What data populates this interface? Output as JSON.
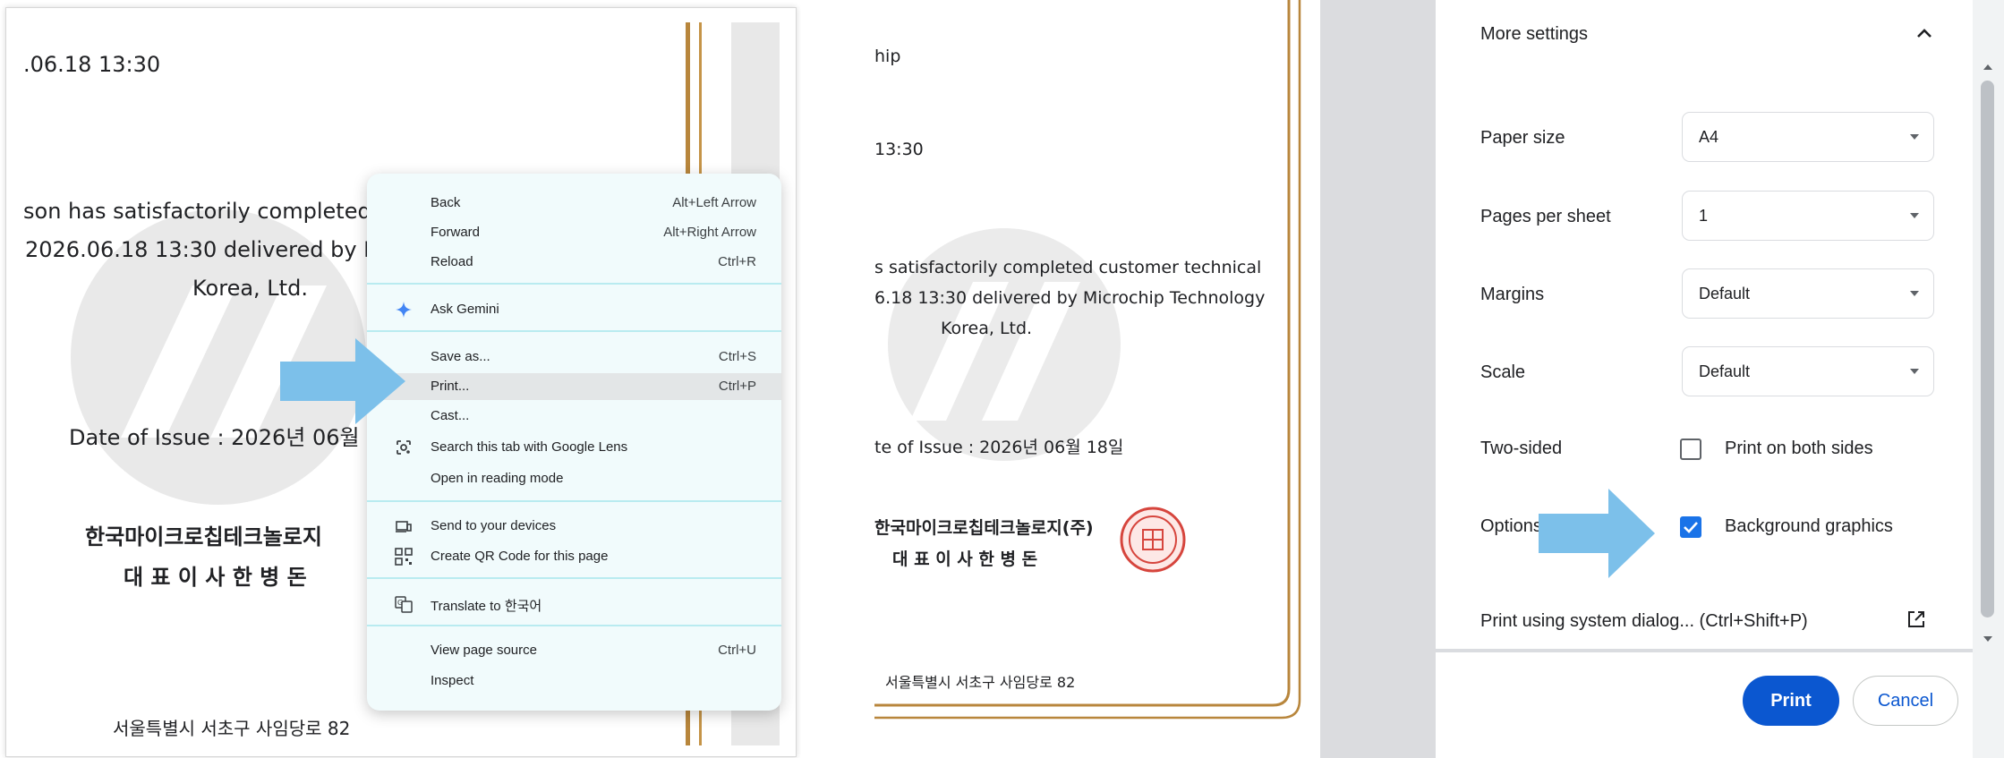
{
  "left_doc": {
    "datetime": ".06.18 13:30",
    "line1": "son has satisfactorily completed",
    "line2": "2026.06.18 13:30 delivered by M",
    "line3": "Korea, Ltd.",
    "issue": "Date of Issue : 2026년 06월",
    "company": "한국마이크로칩테크놀로지",
    "ceo": "대 표 이 사  한 병 돈",
    "address": "서울특별시 서초구 사임당로 82"
  },
  "context_menu": {
    "items": [
      {
        "label": "Back",
        "shortcut": "Alt+Left Arrow"
      },
      {
        "label": "Forward",
        "shortcut": "Alt+Right Arrow"
      },
      {
        "label": "Reload",
        "shortcut": "Ctrl+R"
      },
      {
        "label": "Ask Gemini",
        "icon": "gemini-sparkle-icon"
      },
      {
        "label": "Save as...",
        "shortcut": "Ctrl+S"
      },
      {
        "label": "Print...",
        "shortcut": "Ctrl+P",
        "highlighted": true
      },
      {
        "label": "Cast..."
      },
      {
        "label": "Search this tab with Google Lens",
        "icon": "google-lens-icon"
      },
      {
        "label": "Open in reading mode"
      },
      {
        "label": "Send to your devices",
        "icon": "devices-icon"
      },
      {
        "label": "Create QR Code for this page",
        "icon": "qr-code-icon"
      },
      {
        "label": "Translate to 한국어",
        "icon": "translate-icon"
      },
      {
        "label": "View page source",
        "shortcut": "Ctrl+U"
      },
      {
        "label": "Inspect"
      }
    ]
  },
  "right_doc": {
    "line0": "hip",
    "datetime": "13:30",
    "line1": "s satisfactorily completed customer technical",
    "line2": "6.18 13:30 delivered by Microchip Technology",
    "line3": "Korea, Ltd.",
    "issue": "te of Issue : 2026년 06월 18일",
    "company": "한국마이크로칩테크놀로지(주)",
    "ceo": "대 표 이 사  한 병 돈",
    "address": "서울특별시 서초구 사임당로 82"
  },
  "print_settings": {
    "section_title": "More settings",
    "paper_size": {
      "label": "Paper size",
      "value": "A4"
    },
    "pages_per_sheet": {
      "label": "Pages per sheet",
      "value": "1"
    },
    "margins": {
      "label": "Margins",
      "value": "Default"
    },
    "scale": {
      "label": "Scale",
      "value": "Default"
    },
    "two_sided": {
      "label": "Two-sided",
      "checkbox_label": "Print on both sides",
      "checked": false
    },
    "options": {
      "label": "Options",
      "checkbox_label": "Background graphics",
      "checked": true
    },
    "system_dialog": "Print using system dialog... (Ctrl+Shift+P)",
    "print_button": "Print",
    "cancel_button": "Cancel"
  },
  "colors": {
    "accent_blue": "#0b57d0",
    "checkbox_blue": "#1a73e8",
    "arrow_blue": "#7cc0ea",
    "gold_border": "#b8863c",
    "menu_bg": "#f1fbfc",
    "menu_separator": "#b9ebf0",
    "seal_red": "#d6453d"
  }
}
